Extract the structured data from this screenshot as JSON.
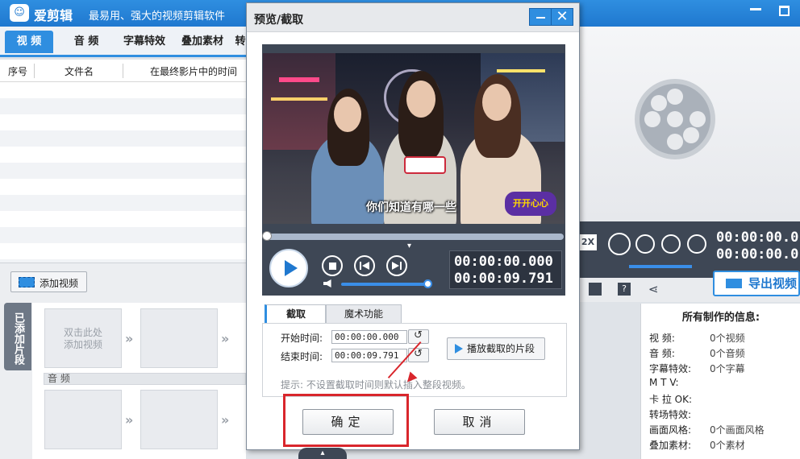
{
  "app": {
    "logo": "☺",
    "name": "爱剪辑",
    "slogan": "最易用、强大的视频剪辑软件"
  },
  "main_tabs": [
    {
      "label": "视 频"
    },
    {
      "label": "音 频"
    },
    {
      "label": "字幕特效"
    },
    {
      "label": "叠加素材"
    },
    {
      "label": "转"
    }
  ],
  "file_list": {
    "columns": [
      "序号",
      "文件名",
      "在最终影片中的时间"
    ]
  },
  "left_bottom": {
    "add_video_label": "添加视频",
    "side_label": "已添加片段",
    "slot_placeholder_line1": "双击此处",
    "slot_placeholder_line2": "添加视频",
    "audio_label": "音 频"
  },
  "dialog": {
    "title": "预览/截取",
    "close_glyph": "✕",
    "subtitle": "你们知道有哪一些",
    "badge": "开开心心",
    "time_current": "00:00:00.000",
    "time_total": "00:00:09.791",
    "tabs": [
      {
        "label": "截取"
      },
      {
        "label": "魔术功能"
      }
    ],
    "start_label": "开始时间:",
    "start_value": "00:00:00.000",
    "end_label": "结束时间:",
    "end_value": "00:00:09.791",
    "play_clip_label": "播放截取的片段",
    "hint": "提示: 不设置截取时间则默认插入整段视频。",
    "ok_label": "确定",
    "cancel_label": "取消"
  },
  "right": {
    "speed_label": "2X",
    "time_line1": "00:00:00.0",
    "time_line2": "00:00:00.0",
    "export_label": "导出视频",
    "info_title": "所有制作的信息:",
    "info_rows": [
      {
        "k": "视 频:",
        "v": "0个视频"
      },
      {
        "k": "音 频:",
        "v": "0个音频"
      },
      {
        "k": "字幕特效:",
        "v": "0个字幕"
      },
      {
        "k": "M T V:",
        "v": ""
      },
      {
        "k": "卡 拉 OK:",
        "v": ""
      },
      {
        "k": "转场特效:",
        "v": ""
      },
      {
        "k": "画面风格:",
        "v": "0个画面风格"
      },
      {
        "k": "叠加素材:",
        "v": "0个素材"
      }
    ]
  },
  "colors": {
    "accent": "#2f8ee0",
    "player_bg": "#3e4755",
    "annotation_red": "#d9262c"
  }
}
